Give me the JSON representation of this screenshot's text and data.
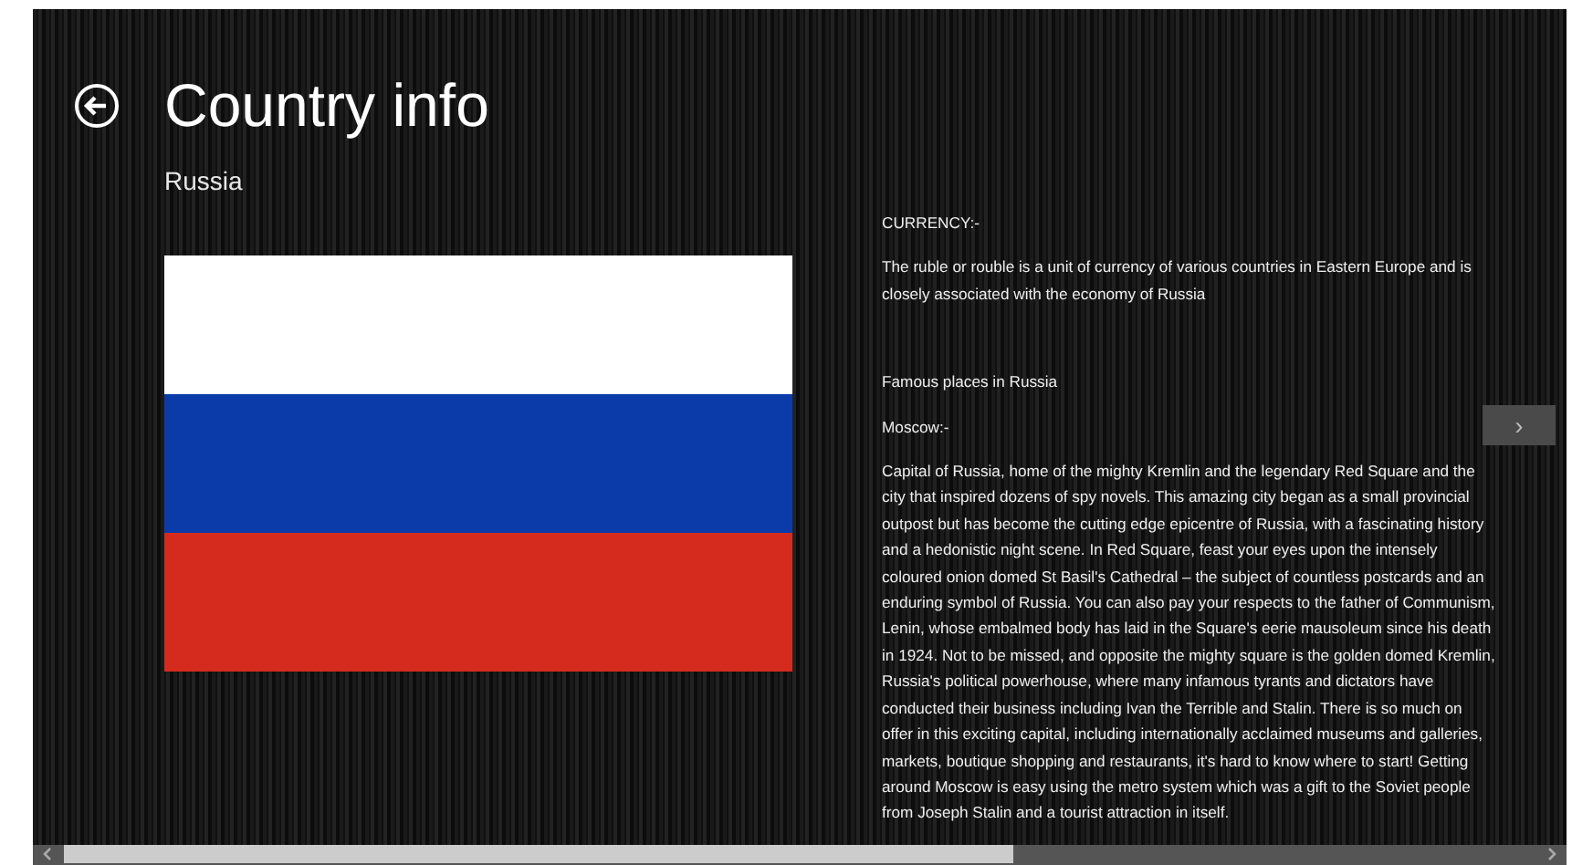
{
  "page": {
    "title": "Country info",
    "subtitle": "Russia"
  },
  "flag": {
    "stripes": [
      {
        "color": "#ffffff"
      },
      {
        "color": "#0b3ba8"
      },
      {
        "color": "#d52b1e"
      }
    ]
  },
  "info": [
    {
      "kind": "label",
      "text": "CURRENCY:-"
    },
    {
      "kind": "paragraph",
      "text": "The ruble or rouble  is a unit of currency of various countries in Eastern Europe and is closely associated with the economy of Russia"
    },
    {
      "kind": "gap"
    },
    {
      "kind": "label",
      "text": "Famous places in Russia"
    },
    {
      "kind": "label",
      "text": "Moscow:-"
    },
    {
      "kind": "paragraph",
      "text": "Capital of Russia, home of the mighty Kremlin and the legendary Red Square and the city that inspired dozens of spy novels. This amazing city began as a small provincial outpost but has become the cutting edge epicentre of Russia, with a fascinating history and a hedonistic night scene. In Red Square, feast your eyes upon the intensely coloured onion domed St Basil's Cathedral – the subject of countless postcards and an enduring symbol of Russia. You can also pay your respects to the father of Communism, Lenin, whose embalmed body has laid in the Square's eerie mausoleum since his death in 1924. Not to be missed, and opposite the mighty square is the golden domed Kremlin, Russia's political powerhouse, where many infamous tyrants and dictators have conducted their business including Ivan the Terrible and Stalin. There is so much on offer in this exciting capital, including internationally acclaimed museums and galleries, markets, boutique shopping and restaurants, it's hard to know where to start! Getting around Moscow is easy using the metro system which was a gift to the Soviet people from Joseph Stalin and a tourist attraction in itself."
    }
  ],
  "next_button": {
    "label": "›"
  }
}
